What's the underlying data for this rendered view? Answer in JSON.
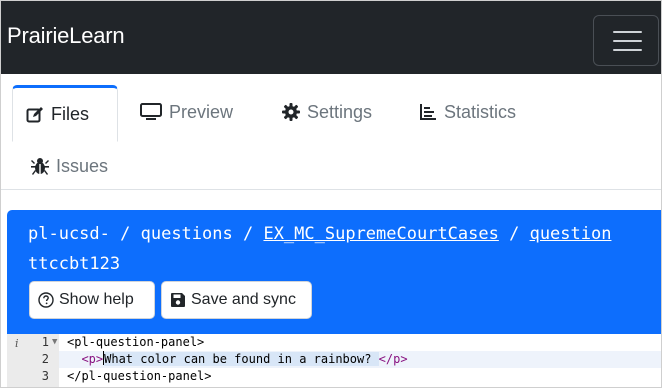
{
  "navbar": {
    "brand": "PrairieLearn"
  },
  "tabs": [
    {
      "label": "Files",
      "icon": "edit-icon",
      "active": true
    },
    {
      "label": "Preview",
      "icon": "monitor-icon"
    },
    {
      "label": "Settings",
      "icon": "gear-icon"
    },
    {
      "label": "Statistics",
      "icon": "bar-chart-icon"
    },
    {
      "label": "Issues",
      "icon": "bug-icon"
    }
  ],
  "header": {
    "path_start": "pl-ucsd-",
    "path_sep1": " / ",
    "path_questions": "questions",
    "path_sep2": " / ",
    "path_folder": "EX_MC_SupremeCourtCases",
    "path_sep3": " / ",
    "path_more": "question",
    "path_line2": "ttccbt123",
    "help_label": "Show help",
    "save_label": "Save and sync"
  },
  "editor": {
    "lines": [
      {
        "num": "1",
        "text": "<pl-question-panel>"
      },
      {
        "num": "2",
        "prefix": "  <p>",
        "body": "What color can be found in a rainbow? ",
        "suffix": "</p>"
      },
      {
        "num": "3",
        "text": "</pl-question-panel>"
      }
    ]
  },
  "colors": {
    "navbar": "#212529",
    "accent": "#0d6efd",
    "tag": "#881280"
  }
}
